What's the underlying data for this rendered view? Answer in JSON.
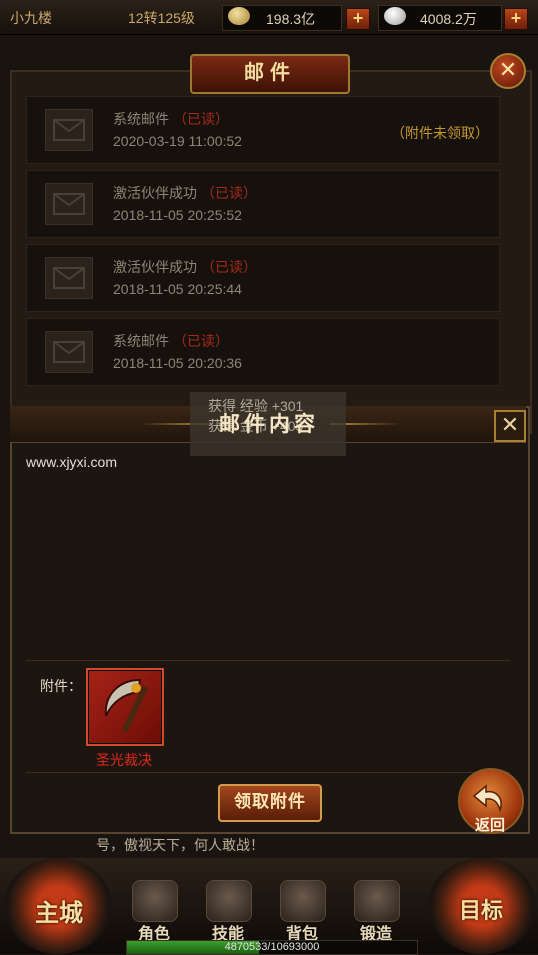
{
  "player": {
    "name": "小九楼",
    "level": "12转125级"
  },
  "currency": {
    "gold": "198.3亿",
    "ingot": "4008.2万",
    "plus_label": "+"
  },
  "mail_panel": {
    "title": "邮件",
    "close": "✕",
    "items": [
      {
        "subject": "系统邮件",
        "status": "（已读）",
        "date": "2020-03-19 11:00:52",
        "attachment": "（附件未领取）"
      },
      {
        "subject": "激活伙伴成功",
        "status": "（已读）",
        "date": "2018-11-05 20:25:52",
        "attachment": ""
      },
      {
        "subject": "激活伙伴成功",
        "status": "（已读）",
        "date": "2018-11-05 20:25:44",
        "attachment": ""
      },
      {
        "subject": "系统邮件",
        "status": "（已读）",
        "date": "2018-11-05 20:20:36",
        "attachment": ""
      }
    ]
  },
  "toast": {
    "line1": "获得 经验 +301",
    "line2": "获得 金币 +405"
  },
  "content_dialog": {
    "title": "邮件内容",
    "close": "✕",
    "body": "www.xjyxi.com",
    "attach_label": "附件：",
    "item_name": "圣光裁决",
    "claim_button": "领取附件",
    "back_label": "返回"
  },
  "chat": {
    "text": "号，傲视天下，何人敢战！"
  },
  "bottom_nav": {
    "main_city": "主城",
    "target": "目标",
    "items": [
      "角色",
      "技能",
      "背包",
      "锻造"
    ]
  },
  "exp": {
    "text": "4870533/10693000",
    "fraction": 0.4555
  }
}
